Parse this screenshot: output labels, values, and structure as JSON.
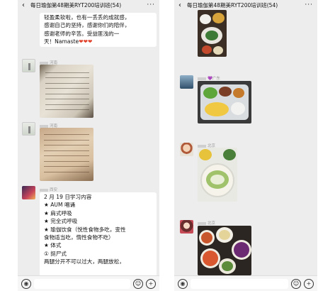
{
  "left": {
    "header": {
      "back_icon": "chevron-left-icon",
      "title": "每日瑜伽第48期美RYT200培训班(54)",
      "more_icon": "ellipsis-icon"
    },
    "top_message": {
      "lines": [
        "轻盈柔软啦，也有一丢丢的成就感，",
        "感谢自己的坚持，感谢你们的陪伴，",
        "感谢老师的辛苦。受益匪浅的一",
        "天！Namaste❤❤❤"
      ]
    },
    "msg2": {
      "location": "河南",
      "image": "handwritten-notes-photo"
    },
    "msg3": {
      "location": "河南",
      "image": "handwritten-notes-photo"
    },
    "msg4": {
      "location": "西安",
      "lines": [
        "2 月 19 日学习内容",
        "★ AUM 唱诵",
        "★ 肩式呼吸",
        "★ 完全式呼吸",
        "★ 瑜伽饮食（悦性食物多吃，变性",
        "食物适当吃，惰性食物不吃）",
        "★ 体式",
        "① 挺尸式",
        "两腿分开不可以过大，两腿放松，"
      ]
    },
    "footer": {
      "voice_icon": "voice-icon",
      "emoji_icon": "emoji-icon",
      "plus_icon": "plus-icon"
    }
  },
  "right": {
    "header": {
      "back_icon": "chevron-left-icon",
      "title": "每日瑜伽第48期美RYT200培训班(54)",
      "more_icon": "ellipsis-icon"
    },
    "msg1": {
      "image": "meal-photo"
    },
    "msg2": {
      "name_suffix": "💜",
      "location": "广东",
      "image": "meal-tray-photo"
    },
    "msg3": {
      "location": "北京",
      "image": "soup-meal-photo"
    },
    "msg4": {
      "location": "北京",
      "image": "vegetable-dishes-photo"
    },
    "footer": {
      "voice_icon": "voice-icon",
      "emoji_icon": "emoji-icon",
      "plus_icon": "plus-icon"
    }
  },
  "colors": {
    "chat_bg": "#ededed",
    "bubble_bg": "#ffffff",
    "heart": "#e0422b"
  }
}
